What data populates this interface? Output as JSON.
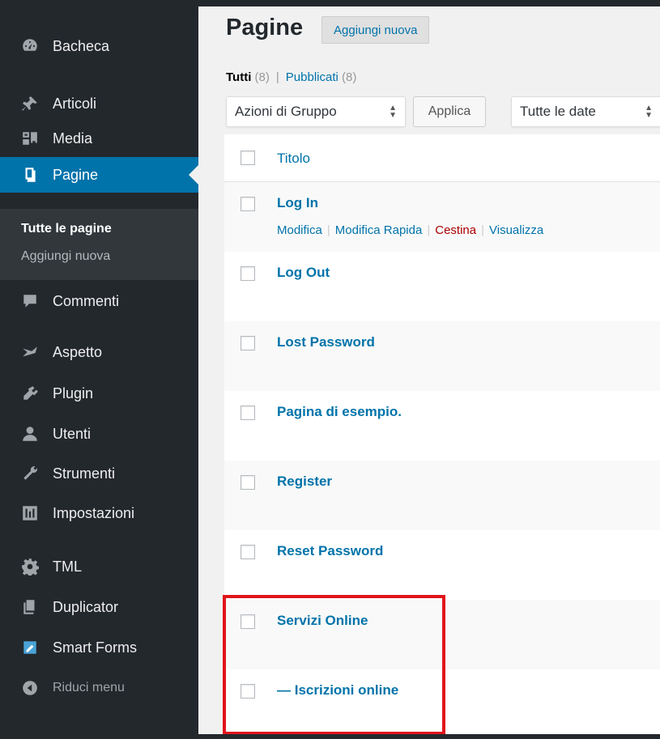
{
  "sidebar": {
    "items": [
      {
        "label": "Bacheca",
        "icon": "dashboard-icon"
      },
      {
        "label": "Articoli",
        "icon": "pin-icon"
      },
      {
        "label": "Media",
        "icon": "media-icon"
      },
      {
        "label": "Pagine",
        "icon": "pages-icon",
        "current": true
      },
      {
        "label": "Commenti",
        "icon": "comment-icon"
      },
      {
        "label": "Aspetto",
        "icon": "brush-icon"
      },
      {
        "label": "Plugin",
        "icon": "plugin-icon"
      },
      {
        "label": "Utenti",
        "icon": "user-icon"
      },
      {
        "label": "Strumenti",
        "icon": "wrench-icon"
      },
      {
        "label": "Impostazioni",
        "icon": "settings-icon"
      },
      {
        "label": "TML",
        "icon": "gear-icon"
      },
      {
        "label": "Duplicator",
        "icon": "duplicator-icon"
      },
      {
        "label": "Smart Forms",
        "icon": "smart-forms-icon"
      }
    ],
    "submenu": [
      "Tutte le pagine",
      "Aggiungi nuova"
    ],
    "collapse_label": "Riduci menu"
  },
  "header": {
    "title": "Pagine",
    "add_new": "Aggiungi nuova"
  },
  "filters": {
    "all_label": "Tutti",
    "all_count": "(8)",
    "published_label": "Pubblicati",
    "published_count": "(8)",
    "separator": "|"
  },
  "bulk": {
    "actions": "Azioni di Gruppo",
    "apply": "Applica",
    "dates": "Tutte le date"
  },
  "table": {
    "column_title": "Titolo",
    "rows": [
      "Log In",
      "Log Out",
      "Lost Password",
      "Pagina di esempio.",
      "Register",
      "Reset Password",
      "Servizi Online",
      "— Iscrizioni online"
    ],
    "row_actions": {
      "edit": "Modifica",
      "quick_edit": "Modifica Rapida",
      "trash": "Cestina",
      "view": "Visualizza"
    }
  },
  "colors": {
    "sidebar_bg": "#23282d",
    "accent": "#0073aa",
    "highlight": "#e1141b",
    "trash": "#a00000"
  }
}
